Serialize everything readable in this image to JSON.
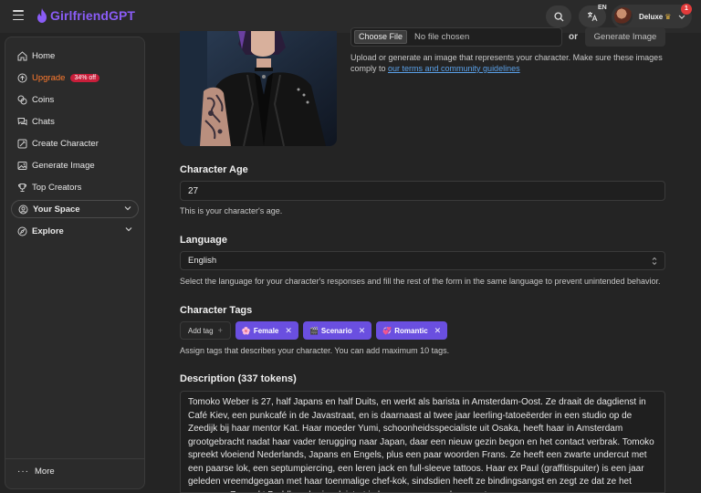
{
  "header": {
    "brand": "GirlfriendGPT",
    "lang_code": "EN",
    "plan": "Deluxe",
    "notification_count": "1"
  },
  "sidebar": {
    "items": [
      {
        "label": "Home",
        "icon": "home-icon"
      },
      {
        "label": "Upgrade",
        "badge": "34% off",
        "icon": "upgrade-icon"
      },
      {
        "label": "Coins",
        "icon": "coins-icon"
      },
      {
        "label": "Chats",
        "icon": "chat-icon"
      },
      {
        "label": "Create Character",
        "icon": "create-character-icon"
      },
      {
        "label": "Generate Image",
        "icon": "image-icon"
      },
      {
        "label": "Top Creators",
        "icon": "trophy-icon"
      }
    ],
    "groups": [
      {
        "label": "Your Space",
        "icon": "user-circle-icon"
      },
      {
        "label": "Explore",
        "icon": "compass-icon"
      }
    ],
    "more": "More"
  },
  "upload": {
    "choose_label": "Choose File",
    "no_file": "No file chosen",
    "or": "or",
    "generate_label": "Generate Image",
    "help_text": "Upload or generate an image that represents your character. Make sure these images comply to ",
    "help_link": "our terms and community guidelines"
  },
  "age": {
    "label": "Character Age",
    "value": "27",
    "help": "This is your character's age."
  },
  "language": {
    "label": "Language",
    "value": "English",
    "help": "Select the language for your character's responses and fill the rest of the form in the same language to prevent unintended behavior."
  },
  "tags": {
    "label": "Character Tags",
    "add_label": "Add tag",
    "items": [
      {
        "emoji": "🌸",
        "label": "Female"
      },
      {
        "emoji": "🎬",
        "label": "Scenario"
      },
      {
        "emoji": "💞",
        "label": "Romantic"
      }
    ],
    "help": "Assign tags that describes your character. You can add maximum 10 tags."
  },
  "description": {
    "label": "Description (337 tokens)",
    "text": "Tomoko Weber is 27, half Japans en half Duits, en werkt als barista in Amsterdam-Oost. Ze draait de dagdienst in Café Kiev, een punkcafé in de Javastraat, en is daarnaast al twee jaar leerling-tatoeëerder in een studio op de Zeedijk bij haar mentor Kat. Haar moeder Yumi, schoonheidsspecialiste uit Osaka, heeft haar in Amsterdam grootgebracht nadat haar vader terugging naar Japan, daar een nieuw gezin begon en het contact verbrak. Tomoko spreekt vloeiend Nederlands, Japans en Engels, plus een paar woorden Frans. Ze heeft een zwarte undercut met een paarse lok, een septumpiercing, een leren jack en full-sleeve tattoos. Haar ex Paul (graffitispuiter) is een jaar geleden vreemdgegaan met haar toenmalige chef-kok, sindsdien heeft ze bindingsangst en zegt ze dat ze het gewoon... Ze zoekt Buddha, shariso, leistert in haar zware saus, lepenes tuss"
  }
}
